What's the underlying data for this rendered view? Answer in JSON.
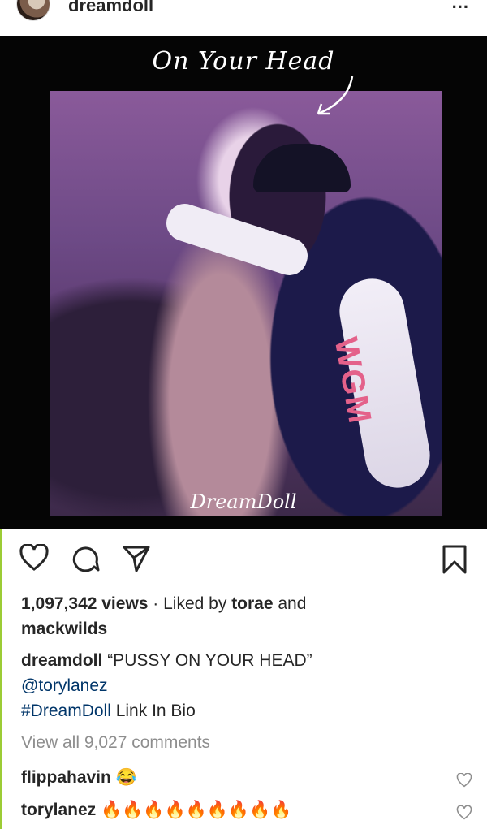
{
  "header": {
    "username": "dreamdoll",
    "more": "..."
  },
  "post": {
    "title_overlay": "On Your Head",
    "signature": "DreamDoll",
    "jacket_text": "WGM"
  },
  "actions": {
    "like_icon": "heart-icon",
    "comment_icon": "comment-icon",
    "share_icon": "send-icon",
    "save_icon": "bookmark-icon"
  },
  "stats": {
    "views": "1,097,342 views",
    "liked_by_prefix": " · Liked by ",
    "liked_user_1": "torae",
    "liked_and": " and",
    "liked_user_2": "mackwilds"
  },
  "caption": {
    "author": "dreamdoll",
    "text": " “PUSSY ON YOUR HEAD”",
    "mention": "@torylanez",
    "hashtag": "#DreamDoll",
    "rest": " Link In Bio"
  },
  "comments_link": "View all 9,027 comments",
  "comments": [
    {
      "user": "flippahavin",
      "text": "😂"
    },
    {
      "user": "torylanez",
      "text": "🔥🔥🔥🔥🔥🔥🔥🔥🔥"
    }
  ]
}
